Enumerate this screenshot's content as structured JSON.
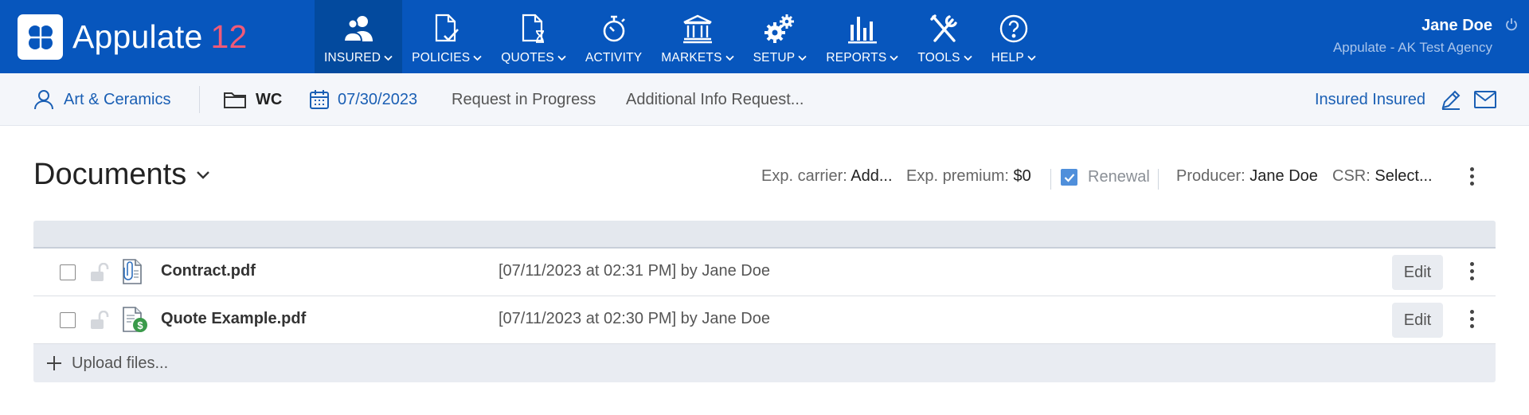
{
  "app": {
    "name": "Appulate",
    "version": "12"
  },
  "nav": [
    {
      "label": "INSURED",
      "icon": "users-icon",
      "active": true,
      "dropdown": true
    },
    {
      "label": "POLICIES",
      "icon": "policy-doc-icon",
      "active": false,
      "dropdown": true
    },
    {
      "label": "QUOTES",
      "icon": "quote-doc-icon",
      "active": false,
      "dropdown": true
    },
    {
      "label": "ACTIVITY",
      "icon": "activity-timer-icon",
      "active": false,
      "dropdown": false
    },
    {
      "label": "MARKETS",
      "icon": "bank-icon",
      "active": false,
      "dropdown": true
    },
    {
      "label": "SETUP",
      "icon": "gears-icon",
      "active": false,
      "dropdown": true
    },
    {
      "label": "REPORTS",
      "icon": "bar-chart-icon",
      "active": false,
      "dropdown": true
    },
    {
      "label": "TOOLS",
      "icon": "tools-icon",
      "active": false,
      "dropdown": true
    },
    {
      "label": "HELP",
      "icon": "help-circle-icon",
      "active": false,
      "dropdown": true
    }
  ],
  "user": {
    "name": "Jane Doe",
    "agency": "Appulate - AK Test Agency"
  },
  "subbar": {
    "insured": "Art & Ceramics",
    "lob": "WC",
    "date": "07/30/2023",
    "status": "Request in Progress",
    "info": "Additional Info Request...",
    "insured_link": "Insured Insured"
  },
  "documents": {
    "title": "Documents",
    "exp_carrier_label": "Exp. carrier:",
    "exp_carrier_value": "Add...",
    "exp_premium_label": "Exp. premium:",
    "exp_premium_value": "$0",
    "renewal_label": "Renewal",
    "renewal_checked": true,
    "producer_label": "Producer:",
    "producer_value": "Jane Doe",
    "csr_label": "CSR:",
    "csr_value": "Select..."
  },
  "files": [
    {
      "name": "Contract.pdf",
      "date": "[07/11/2023 at 02:31 PM] by Jane Doe",
      "icon": "clip-document-icon",
      "edit_label": "Edit"
    },
    {
      "name": "Quote Example.pdf",
      "date": "[07/11/2023 at 02:30 PM] by Jane Doe",
      "icon": "dollar-document-icon",
      "edit_label": "Edit"
    }
  ],
  "upload_label": "Upload files...",
  "colors": {
    "nav_bg": "#0756bd",
    "nav_active": "#034a9e",
    "accent_link": "#1a5fb4",
    "version": "#f05a78"
  }
}
